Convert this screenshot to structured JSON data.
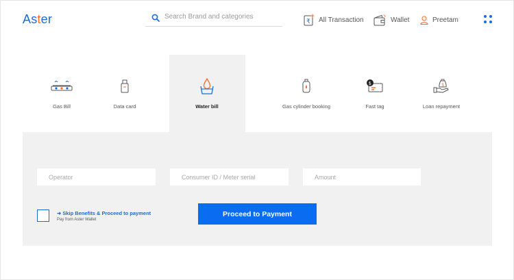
{
  "app": {
    "logo_text": "Aster"
  },
  "header": {
    "search_placeholder": "Search Brand and categories",
    "nav": {
      "transactions_label": "All Transaction",
      "wallet_label": "Wallet",
      "user_label": "Preetam"
    }
  },
  "categories": [
    {
      "label": "Gas Bill",
      "icon": "gas-stove-icon"
    },
    {
      "label": "Data card",
      "icon": "usb-drive-icon"
    },
    {
      "label": "Water bill",
      "icon": "water-drop-icon",
      "active": true
    },
    {
      "label": "Gas cylinder booking",
      "icon": "gas-cylinder-icon"
    },
    {
      "label": "Fast tag",
      "icon": "fast-tag-icon"
    },
    {
      "label": "Loan repayment",
      "icon": "loan-hand-icon"
    }
  ],
  "form": {
    "operator_placeholder": "Operator",
    "consumer_placeholder": "Consumer ID / Meter serial",
    "amount_placeholder": "Amount",
    "skip_label": "➜ Skip Benefits & Proceed to payment",
    "skip_sublabel": "Pay from Aster Wallet",
    "proceed_label": "Proceed to Payment"
  },
  "colors": {
    "brand": "#1a6bd6",
    "accent": "#ff6a2b",
    "button": "#0a6cf0",
    "panel": "#f1f1f1"
  }
}
